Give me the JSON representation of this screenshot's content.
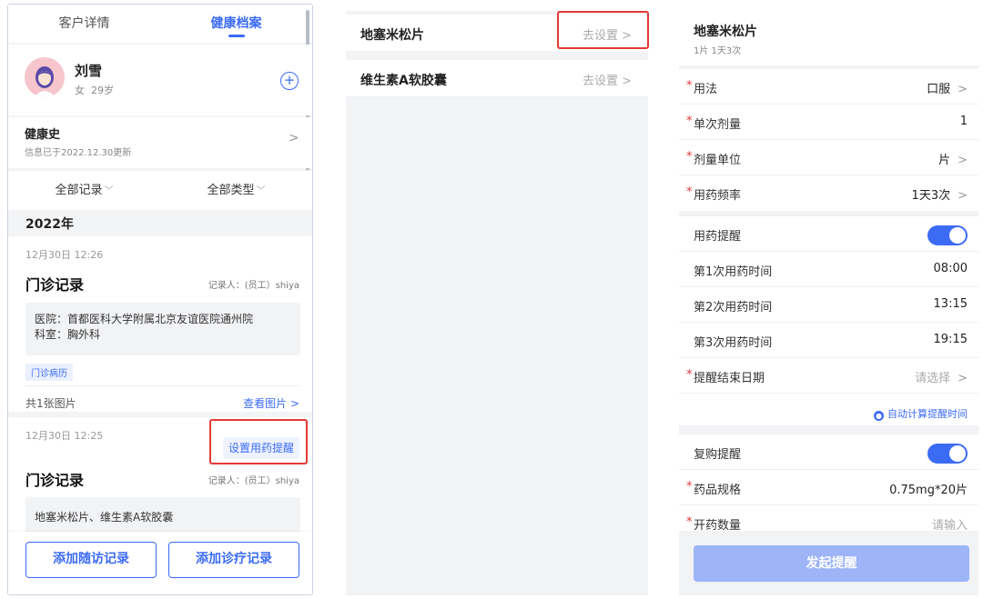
{
  "panel1": {
    "tabs": [
      "客户详情",
      "健康档案"
    ],
    "customer": {
      "name": "刘雪",
      "gender": "女",
      "age": "29岁",
      "add": "+"
    },
    "history": {
      "title": "健康史",
      "subtitle": "信息已于2022.12.30更新",
      "chevron": ">"
    },
    "filters": [
      "全部记录",
      "全部类型"
    ],
    "year": "2022年",
    "records": [
      {
        "time": "12月30日 12:26",
        "title": "门诊记录",
        "recorder": "记录人：(员工）shiya",
        "hospital": "医院：首都医科大学附属北京友谊医院通州院",
        "dept": "科室：胸外科",
        "tag": "门诊病历",
        "image_count": "共1张图片",
        "view_images": "查看图片 >"
      },
      {
        "time": "12月30日 12:25",
        "action": "设置用药提醒",
        "title": "门诊记录",
        "recorder": "记录人：(员工）shiya",
        "content": "地塞米松片、维生素A软胶囊"
      }
    ],
    "buttons": [
      "添加随访记录",
      "添加诊疗记录"
    ]
  },
  "panel2": {
    "meds": [
      {
        "name": "地塞米松片",
        "action": "去设置 >"
      },
      {
        "name": "维生素A软胶囊",
        "action": "去设置 >"
      }
    ]
  },
  "panel3": {
    "drug": {
      "name": "地塞米松片",
      "summary": "1片 1天3次"
    },
    "fields1": [
      {
        "label": "用法",
        "value": "口服",
        "required": true,
        "chevron": true
      },
      {
        "label": "单次剂量",
        "value": "1",
        "required": true,
        "chevron": false
      },
      {
        "label": "剂量单位",
        "value": "片",
        "required": true,
        "chevron": true
      },
      {
        "label": "用药频率",
        "value": "1天3次",
        "required": true,
        "chevron": true
      }
    ],
    "reminder": {
      "label": "用药提醒",
      "on": true,
      "times": [
        {
          "label": "第1次用药时间",
          "value": "08:00"
        },
        {
          "label": "第2次用药时间",
          "value": "13:15"
        },
        {
          "label": "第3次用药时间",
          "value": "19:15"
        }
      ],
      "end_date": {
        "label": "提醒结束日期",
        "placeholder": "请选择"
      },
      "auto_calc": "自动计算提醒时间"
    },
    "rebuy": {
      "label": "复购提醒",
      "on": true,
      "spec": {
        "label": "药品规格",
        "value": "0.75mg*20片"
      },
      "qty": {
        "label": "开药数量",
        "placeholder": "请输入"
      }
    },
    "submit": "发起提醒"
  },
  "colors": {
    "accent": "#3b6bf5",
    "highlight": "#e53935",
    "required": "#e53935"
  }
}
